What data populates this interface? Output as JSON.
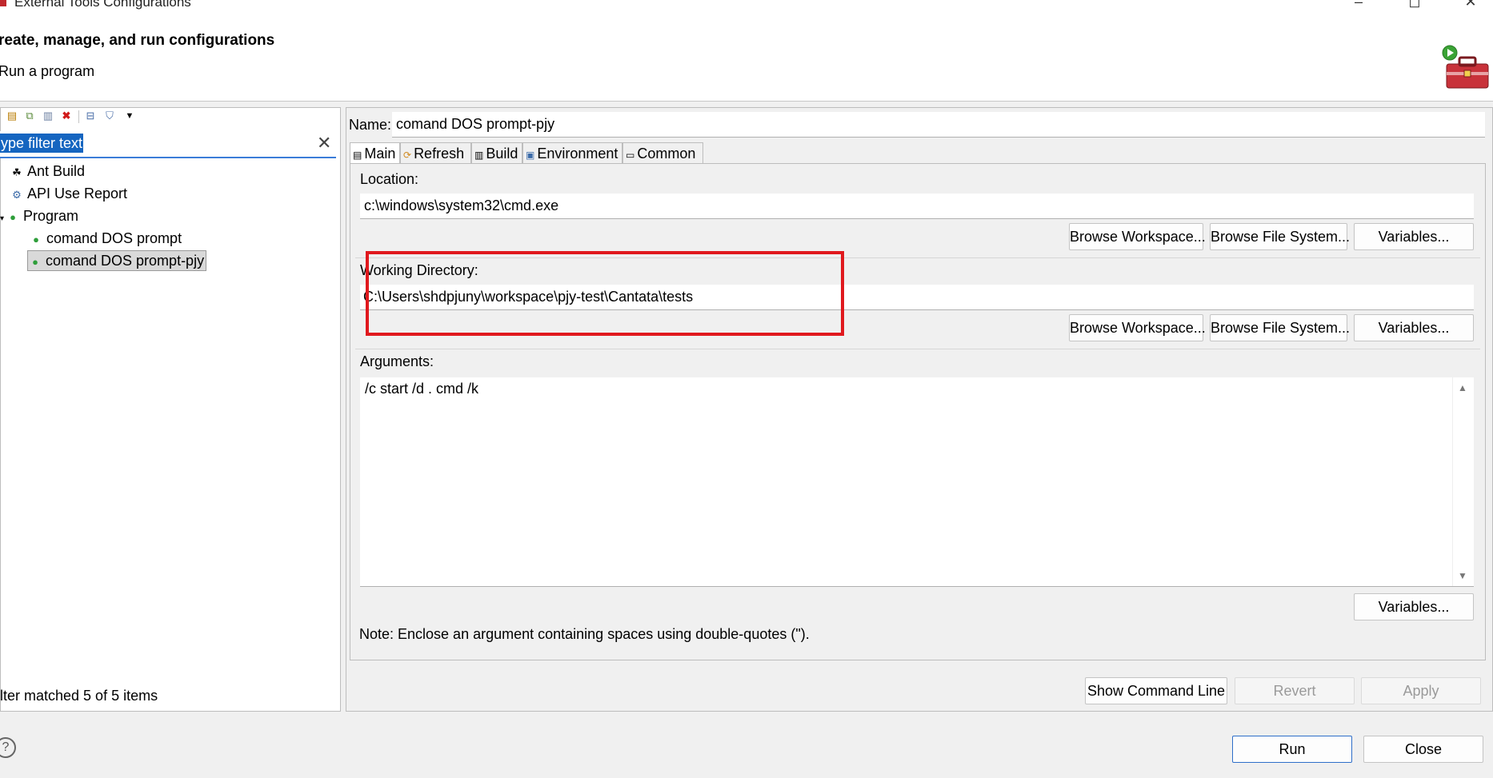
{
  "window": {
    "title": "External Tools Configurations",
    "controls": {
      "minimize": "–",
      "maximize": "◻",
      "close": "✕"
    }
  },
  "header": {
    "title": "reate, manage, and run configurations",
    "subtitle": "Run a program"
  },
  "left": {
    "toolbar_icons": [
      "new-configuration-icon",
      "duplicate-icon",
      "export-icon",
      "delete-icon",
      "collapse-all-icon",
      "filter-icon",
      "view-menu-icon"
    ],
    "filter_text": "ype filter text",
    "tree": [
      {
        "label": "Ant Build",
        "icon": "ant-icon",
        "level": 0
      },
      {
        "label": "API Use Report",
        "icon": "api-report-icon",
        "level": 0
      },
      {
        "label": "Program",
        "icon": "program-icon",
        "level": 0,
        "expanded": true
      },
      {
        "label": "comand DOS prompt",
        "icon": "program-config-icon",
        "level": 1
      },
      {
        "label": "comand DOS prompt-pjy",
        "icon": "program-config-icon",
        "level": 1,
        "selected": true
      }
    ],
    "filter_status": "lter matched 5 of 5 items"
  },
  "form": {
    "name_label": "Name:",
    "name_value": "comand DOS prompt-pjy",
    "tabs": [
      {
        "label": "Main",
        "icon": "main-tab-icon",
        "active": true
      },
      {
        "label": "Refresh",
        "icon": "refresh-tab-icon"
      },
      {
        "label": "Build",
        "icon": "build-tab-icon"
      },
      {
        "label": "Environment",
        "icon": "environment-tab-icon"
      },
      {
        "label": "Common",
        "icon": "common-tab-icon"
      }
    ],
    "location_label": "Location:",
    "location_value": "c:\\windows\\system32\\cmd.exe",
    "working_dir_label": "Working Directory:",
    "working_dir_value": "C:\\Users\\shdpjuny\\workspace\\pjy-test\\Cantata\\tests",
    "arguments_label": "Arguments:",
    "arguments_value": "/c start /d . cmd /k",
    "note": "Note: Enclose an argument containing spaces using double-quotes (\").",
    "browse_workspace": "Browse Workspace...",
    "browse_file_system": "Browse File System...",
    "variables": "Variables..."
  },
  "bottom": {
    "show_command_line": "Show Command Line",
    "revert": "Revert",
    "apply": "Apply",
    "run": "Run",
    "close": "Close",
    "help": "?"
  },
  "colors": {
    "highlight_box": "#e0191e",
    "selection": "#1565c0",
    "default_button_border": "#2f6fc9"
  }
}
